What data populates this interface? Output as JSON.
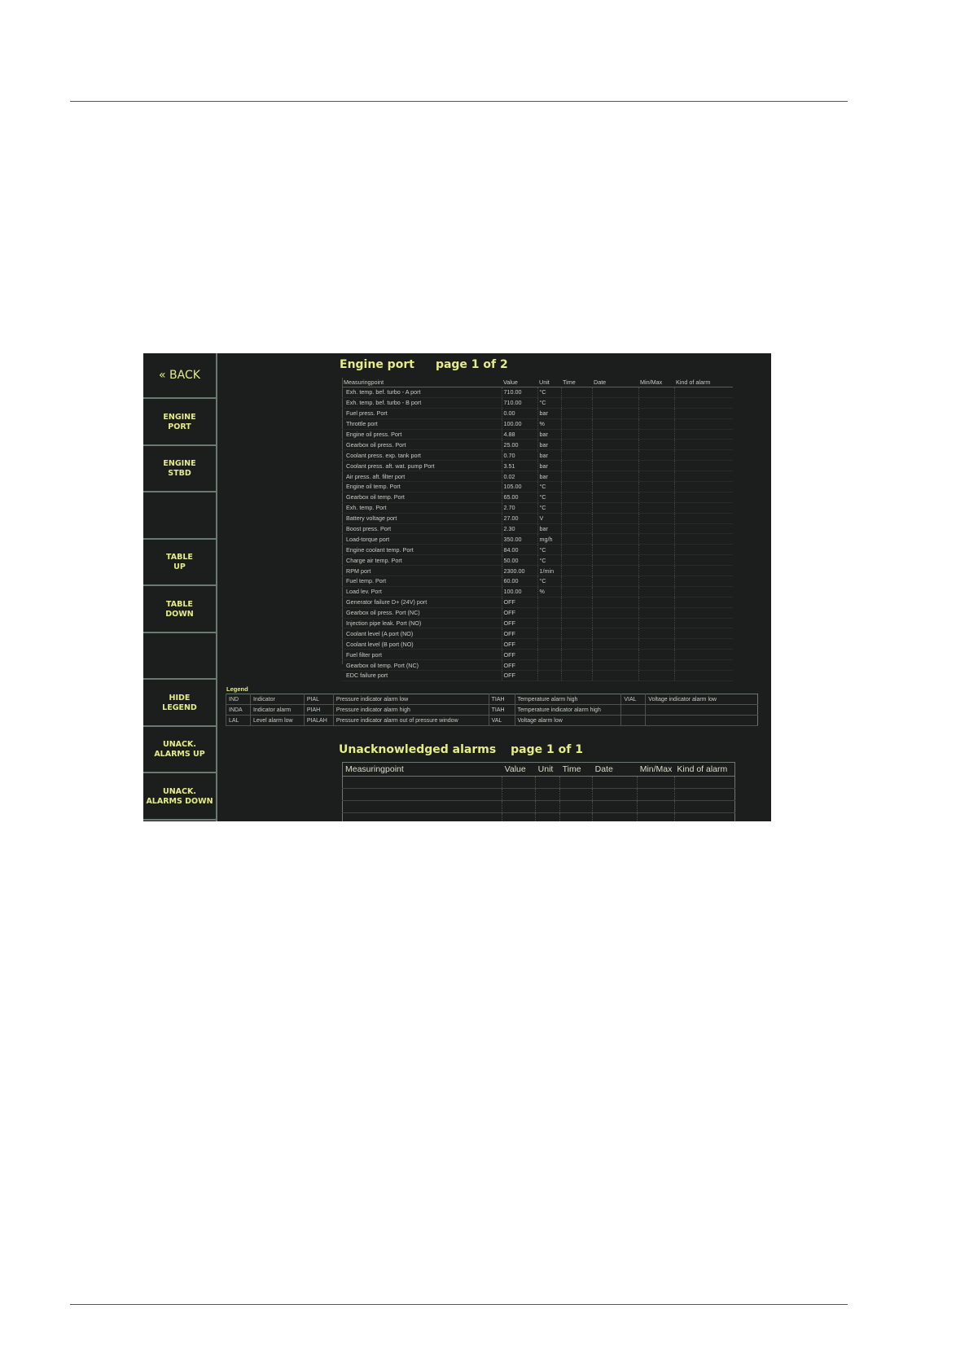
{
  "screen": {
    "sidebar": [
      {
        "label": "« BACK"
      },
      {
        "label": "ENGINE\nPORT"
      },
      {
        "label": "ENGINE\nSTBD"
      },
      {
        "label": ""
      },
      {
        "label": "TABLE\nUP"
      },
      {
        "label": "TABLE\nDOWN"
      },
      {
        "label": ""
      },
      {
        "label": "HIDE\nLEGEND"
      },
      {
        "label": "UNACK.\nALARMS UP"
      },
      {
        "label": "UNACK.\nALARMS DOWN"
      }
    ],
    "engine": {
      "title": "Engine port",
      "page": "page 1 of 2",
      "columns": [
        "Measuringpoint",
        "Value",
        "Unit",
        "Time",
        "Date",
        "Min/Max",
        "Kind of alarm"
      ],
      "rows": [
        [
          "Exh. temp. bef. turbo - A port",
          "710.00",
          "°C"
        ],
        [
          "Exh. temp. bef. turbo - B port",
          "710.00",
          "°C"
        ],
        [
          "Fuel press. Port",
          "0.00",
          "bar"
        ],
        [
          "Throttle port",
          "100.00",
          "%"
        ],
        [
          "Engine oil press. Port",
          "4.88",
          "bar"
        ],
        [
          "Gearbox oil press. Port",
          "25.00",
          "bar"
        ],
        [
          "Coolant press. exp. tank port",
          "0.70",
          "bar"
        ],
        [
          "Coolant press. aft. wat. pump Port",
          "3.51",
          "bar"
        ],
        [
          "Air press. aft. filter port",
          "0.02",
          "bar"
        ],
        [
          "Engine oil temp. Port",
          "105.00",
          "°C"
        ],
        [
          "Gearbox oil temp. Port",
          "65.00",
          "°C"
        ],
        [
          "Exh. temp. Port",
          "2.70",
          "°C"
        ],
        [
          "Battery voltage port",
          "27.00",
          "V"
        ],
        [
          "Boost press. Port",
          "2.30",
          "bar"
        ],
        [
          "Load-torque port",
          "350.00",
          "mg/h"
        ],
        [
          "Engine coolant temp. Port",
          "84.00",
          "°C"
        ],
        [
          "Charge air temp. Port",
          "50.00",
          "°C"
        ],
        [
          "RPM port",
          "2300.00",
          "1/min"
        ],
        [
          "Fuel temp. Port",
          "60.00",
          "°C"
        ],
        [
          "Load lev. Port",
          "100.00",
          "%"
        ],
        [
          "Generator failure D+ (24V) port",
          "OFF",
          ""
        ],
        [
          "Gearbox oil press. Port (NC)",
          "OFF",
          ""
        ],
        [
          "Injection pipe leak. Port (NO)",
          "OFF",
          ""
        ],
        [
          "Coolant level (A port (NO)",
          "OFF",
          ""
        ],
        [
          "Coolant level (B port (NO)",
          "OFF",
          ""
        ],
        [
          "Fuel filter port",
          "OFF",
          ""
        ],
        [
          "Gearbox oil temp. Port (NC)",
          "OFF",
          ""
        ],
        [
          "EDC failure port",
          "OFF",
          ""
        ]
      ]
    },
    "legend": {
      "label": "Legend",
      "rows": [
        [
          "IND",
          "Indicator",
          "PIAL",
          "Pressure indicator alarm low",
          "TIAH",
          "Temperature alarm high",
          "VIAL",
          "Voltage indicator alarm low"
        ],
        [
          "INDA",
          "Indicator alarm",
          "PIAH",
          "Pressure indicator alarm high",
          "TIAH",
          "Temperature indicator alarm high",
          "",
          ""
        ],
        [
          "LAL",
          "Level alarm low",
          "PIALAH",
          "Pressure indicator alarm out of pressure window",
          "VAL",
          "Voltage alarm low",
          "",
          ""
        ]
      ]
    },
    "unack": {
      "title": "Unacknowledged alarms",
      "page": "page 1 of 1",
      "columns": [
        "Measuringpoint",
        "Value",
        "Unit",
        "Time",
        "Date",
        "Min/Max",
        "Kind of alarm"
      ]
    }
  }
}
